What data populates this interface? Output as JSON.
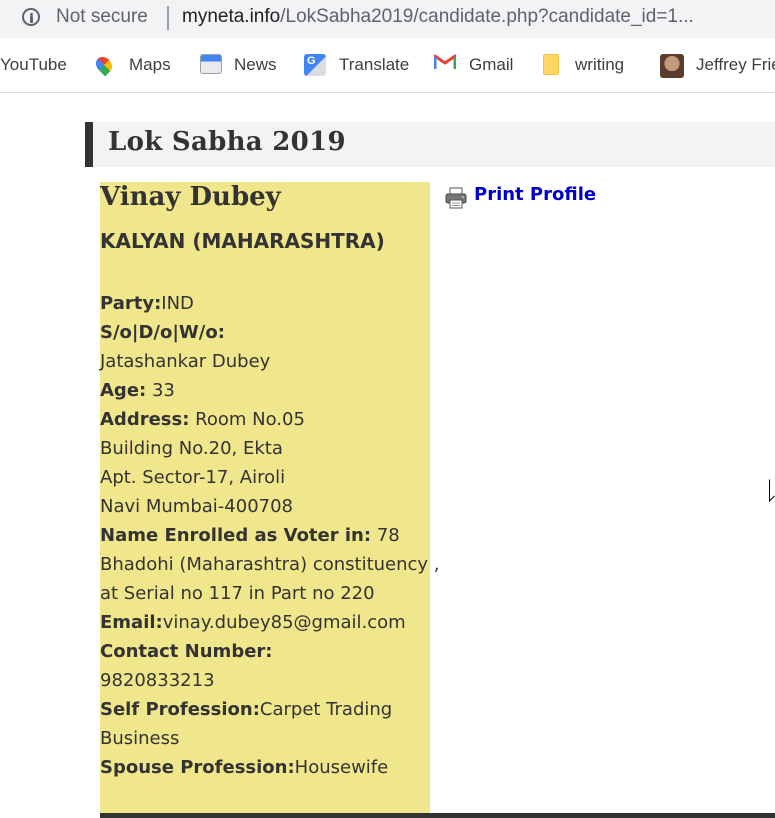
{
  "browser": {
    "security_label": "Not secure",
    "url_domain": "myneta.info",
    "url_path": "/LokSabha2019/candidate.php?candidate_id=1..."
  },
  "bookmarks": [
    {
      "label": "YouTube",
      "icon": "youtube-icon"
    },
    {
      "label": "Maps",
      "icon": "maps-icon"
    },
    {
      "label": "News",
      "icon": "news-icon"
    },
    {
      "label": "Translate",
      "icon": "translate-icon"
    },
    {
      "label": "Gmail",
      "icon": "gmail-icon"
    },
    {
      "label": "writing",
      "icon": "folder-icon"
    },
    {
      "label": "Jeffrey Frie",
      "icon": "avatar"
    }
  ],
  "page": {
    "heading": "Lok Sabha 2019",
    "print_label": "Print Profile"
  },
  "candidate": {
    "name": "Vinay Dubey",
    "constituency": "KALYAN (MAHARASHTRA)",
    "party_label": "Party:",
    "party": "IND",
    "relation_label": "S/o|D/o|W/o:",
    "relation": "Jatashankar Dubey",
    "age_label": "Age:",
    "age": "33",
    "address_label": "Address:",
    "address_lines": [
      "Room No.05",
      "Building No.20, Ekta",
      "Apt. Sector-17, Airoli",
      "Navi Mumbai-400708"
    ],
    "voter_label": "Name Enrolled as Voter in:",
    "voter_lines": [
      "78",
      "Bhadohi (Maharashtra) constituency ,",
      "at Serial no 117 in Part no 220"
    ],
    "email_label": "Email:",
    "email": "vinay.dubey85@gmail.com",
    "contact_label": "Contact Number:",
    "contact": "9820833213",
    "self_profession_label": "Self Profession:",
    "self_profession_lines": [
      "Carpet Trading",
      "Business"
    ],
    "spouse_profession_label": "Spouse Profession:",
    "spouse_profession": "Housewife"
  }
}
